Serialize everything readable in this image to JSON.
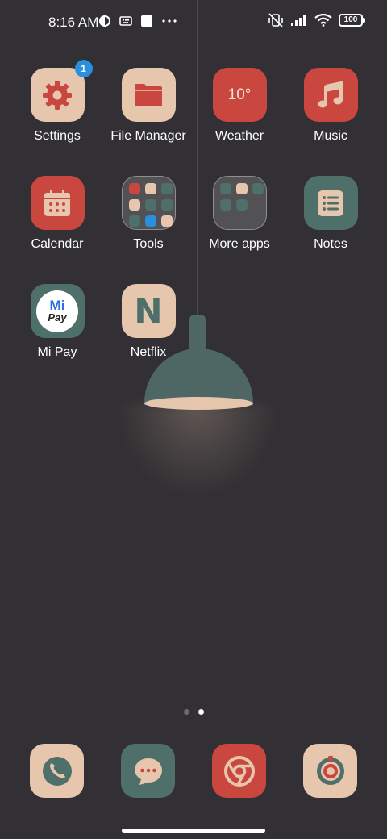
{
  "status_bar": {
    "time": "8:16 AM",
    "battery": "100",
    "left_icons": [
      "notification-app-icon",
      "keyboard-icon",
      "square-icon",
      "more-dots-icon"
    ],
    "right_icons": [
      "vibrate-off-icon",
      "signal-icon",
      "wifi-icon",
      "battery-icon"
    ]
  },
  "apps": [
    {
      "name": "settings",
      "label": "Settings",
      "badge": "1"
    },
    {
      "name": "file-manager",
      "label": "File Manager"
    },
    {
      "name": "weather",
      "label": "Weather",
      "temp": "10°"
    },
    {
      "name": "music",
      "label": "Music"
    },
    {
      "name": "calendar",
      "label": "Calendar"
    },
    {
      "name": "tools",
      "label": "Tools"
    },
    {
      "name": "more-apps",
      "label": "More apps"
    },
    {
      "name": "notes",
      "label": "Notes"
    },
    {
      "name": "mi-pay",
      "label": "Mi Pay",
      "logo_top": "Mi",
      "logo_bottom": "Pay"
    },
    {
      "name": "netflix",
      "label": "Netflix",
      "glyph": "N"
    }
  ],
  "page_indicator": {
    "pages": 2,
    "active": 2
  },
  "dock": [
    "phone",
    "messages",
    "chrome",
    "camera"
  ],
  "colors": {
    "background": "#323034",
    "tan": "#e6c6ac",
    "red": "#c9473e",
    "teal": "#4e6f6a",
    "badge": "#2b8fe0"
  }
}
